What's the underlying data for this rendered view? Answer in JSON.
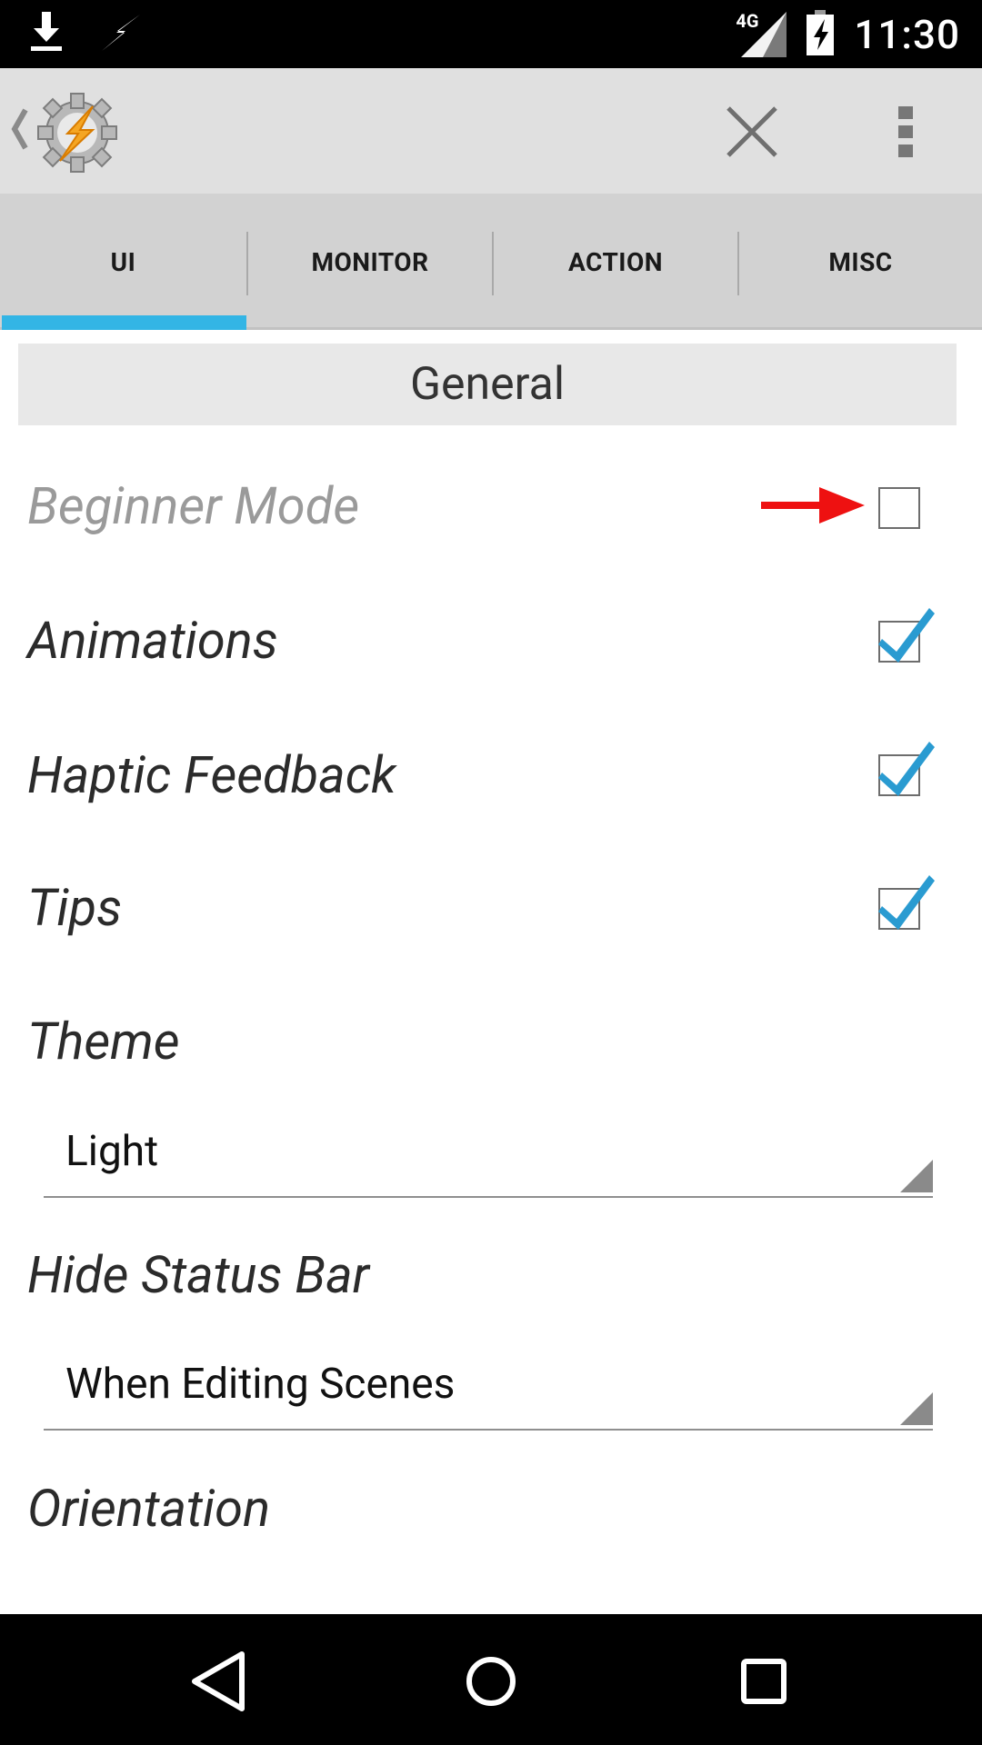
{
  "status_bar": {
    "network": "4G",
    "time": "11:30"
  },
  "tabs": [
    {
      "label": "UI",
      "selected": true
    },
    {
      "label": "MONITOR",
      "selected": false
    },
    {
      "label": "ACTION",
      "selected": false
    },
    {
      "label": "MISC",
      "selected": false
    }
  ],
  "section": {
    "title": "General"
  },
  "settings": {
    "beginner_mode": {
      "label": "Beginner Mode",
      "checked": false
    },
    "animations": {
      "label": "Animations",
      "checked": true
    },
    "haptic_feedback": {
      "label": "Haptic Feedback",
      "checked": true
    },
    "tips": {
      "label": "Tips",
      "checked": true
    },
    "theme": {
      "label": "Theme",
      "value": "Light"
    },
    "hide_status_bar": {
      "label": "Hide Status Bar",
      "value": "When Editing Scenes"
    },
    "orientation": {
      "label": "Orientation"
    }
  },
  "colors": {
    "accent": "#33b5e5",
    "arrow": "#ee1111"
  }
}
